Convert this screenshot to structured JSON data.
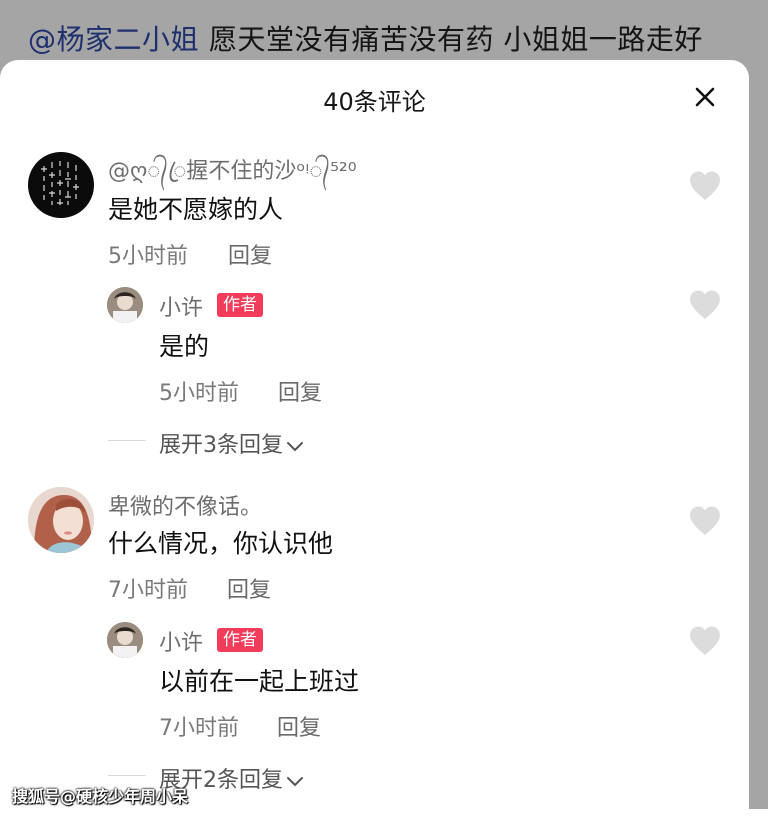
{
  "caption": {
    "mention": "@杨家二小姐",
    "text": "愿天堂没有痛苦没有药  小姐姐一路走好"
  },
  "sheet": {
    "title": "40条评论",
    "close_icon": "close-icon"
  },
  "comments": [
    {
      "username": "@ღ᭄ꦿ握不住的沙ᵒᵎ᭄⁵²⁰",
      "text": "是她不愿嫁的人",
      "time": "5小时前",
      "reply": "回复",
      "replies": [
        {
          "username": "小许",
          "badge": "作者",
          "text": "是的",
          "time": "5小时前",
          "reply": "回复"
        }
      ],
      "expand": "展开3条回复"
    },
    {
      "username": "卑微的不像话。",
      "text": "什么情况，你认识他",
      "time": "7小时前",
      "reply": "回复",
      "replies": [
        {
          "username": "小许",
          "badge": "作者",
          "text": "以前在一起上班过",
          "time": "7小时前",
          "reply": "回复"
        }
      ],
      "expand": "展开2条回复"
    }
  ],
  "like_icon": "heart-icon",
  "colors": {
    "badge": "#f33c5a",
    "overlay": "#a5a5a5",
    "heart": "#dcdcdc"
  },
  "watermark": "搜狐号@硬核少年周小呆"
}
